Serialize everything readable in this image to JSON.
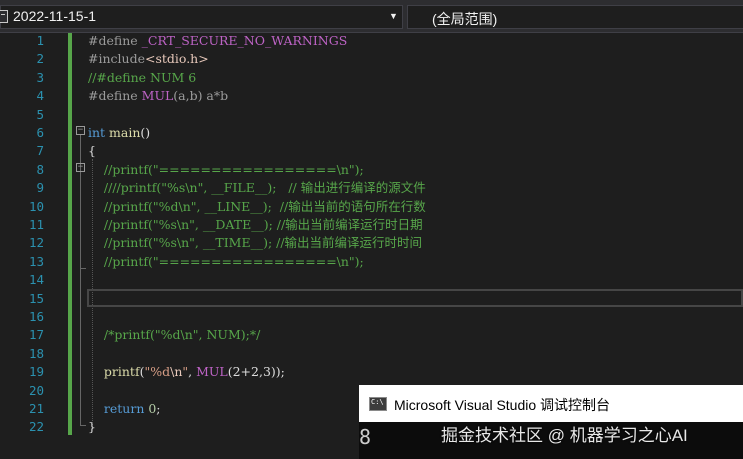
{
  "navbar": {
    "project_name": "2022-11-15-1",
    "scope_label": "(全局范围)"
  },
  "editor": {
    "lines": [
      {
        "n": "1",
        "tokens": [
          {
            "c": "t-pre",
            "t": "#define "
          },
          {
            "c": "t-macro",
            "t": "_CRT_SECURE_NO_WARNINGS"
          }
        ]
      },
      {
        "n": "2",
        "tokens": [
          {
            "c": "t-pre",
            "t": "#include"
          },
          {
            "c": "t-inc",
            "t": "<stdio.h>"
          }
        ]
      },
      {
        "n": "3",
        "tokens": [
          {
            "c": "t-cmt",
            "t": "//#define NUM 6"
          }
        ]
      },
      {
        "n": "4",
        "tokens": [
          {
            "c": "t-pre",
            "t": "#define "
          },
          {
            "c": "t-macro",
            "t": "MUL"
          },
          {
            "c": "t-pre",
            "t": "(a,b) a*b"
          }
        ]
      },
      {
        "n": "5",
        "tokens": []
      },
      {
        "n": "6",
        "tokens": [
          {
            "c": "t-kw",
            "t": "int "
          },
          {
            "c": "t-fn",
            "t": "main"
          },
          {
            "c": "t-plain",
            "t": "()"
          }
        ]
      },
      {
        "n": "7",
        "tokens": [
          {
            "c": "t-plain",
            "t": "{"
          }
        ]
      },
      {
        "n": "8",
        "tokens": [
          {
            "c": "t-cmt",
            "t": "    //printf(\"=================\\n\");"
          }
        ]
      },
      {
        "n": "9",
        "tokens": [
          {
            "c": "t-cmt",
            "t": "    ////printf(\"%s\\n\", __FILE__);   // 输出进行编译的源文件"
          }
        ]
      },
      {
        "n": "10",
        "tokens": [
          {
            "c": "t-cmt",
            "t": "    //printf(\"%d\\n\", __LINE__);  //输出当前的语句所在行数"
          }
        ]
      },
      {
        "n": "11",
        "tokens": [
          {
            "c": "t-cmt",
            "t": "    //printf(\"%s\\n\", __DATE__); //输出当前编译运行时日期"
          }
        ]
      },
      {
        "n": "12",
        "tokens": [
          {
            "c": "t-cmt",
            "t": "    //printf(\"%s\\n\", __TIME__); //输出当前编译运行时时间"
          }
        ]
      },
      {
        "n": "13",
        "tokens": [
          {
            "c": "t-cmt",
            "t": "    //printf(\"=================\\n\");"
          }
        ]
      },
      {
        "n": "14",
        "tokens": []
      },
      {
        "n": "15",
        "tokens": []
      },
      {
        "n": "16",
        "tokens": []
      },
      {
        "n": "17",
        "tokens": [
          {
            "c": "t-cmt",
            "t": "    /*printf(\"%d\\n\", NUM);*/"
          }
        ]
      },
      {
        "n": "18",
        "tokens": []
      },
      {
        "n": "19",
        "tokens": [
          {
            "c": "t-fn",
            "t": "    printf"
          },
          {
            "c": "t-plain",
            "t": "("
          },
          {
            "c": "t-str",
            "t": "\"%d"
          },
          {
            "c": "t-esc",
            "t": "\\n"
          },
          {
            "c": "t-str",
            "t": "\""
          },
          {
            "c": "t-plain",
            "t": ", "
          },
          {
            "c": "t-macro",
            "t": "MUL"
          },
          {
            "c": "t-plain",
            "t": "(2+2,3));"
          }
        ]
      },
      {
        "n": "20",
        "tokens": []
      },
      {
        "n": "21",
        "tokens": [
          {
            "c": "t-kw",
            "t": "    return "
          },
          {
            "c": "t-num",
            "t": "0"
          },
          {
            "c": "t-plain",
            "t": ";"
          }
        ]
      },
      {
        "n": "22",
        "tokens": [
          {
            "c": "t-plain",
            "t": "}"
          }
        ]
      }
    ]
  },
  "console": {
    "title": "Microsoft Visual Studio 调试控制台",
    "output": "8"
  },
  "watermark": "掘金技术社区 @ 机器学习之心AI"
}
